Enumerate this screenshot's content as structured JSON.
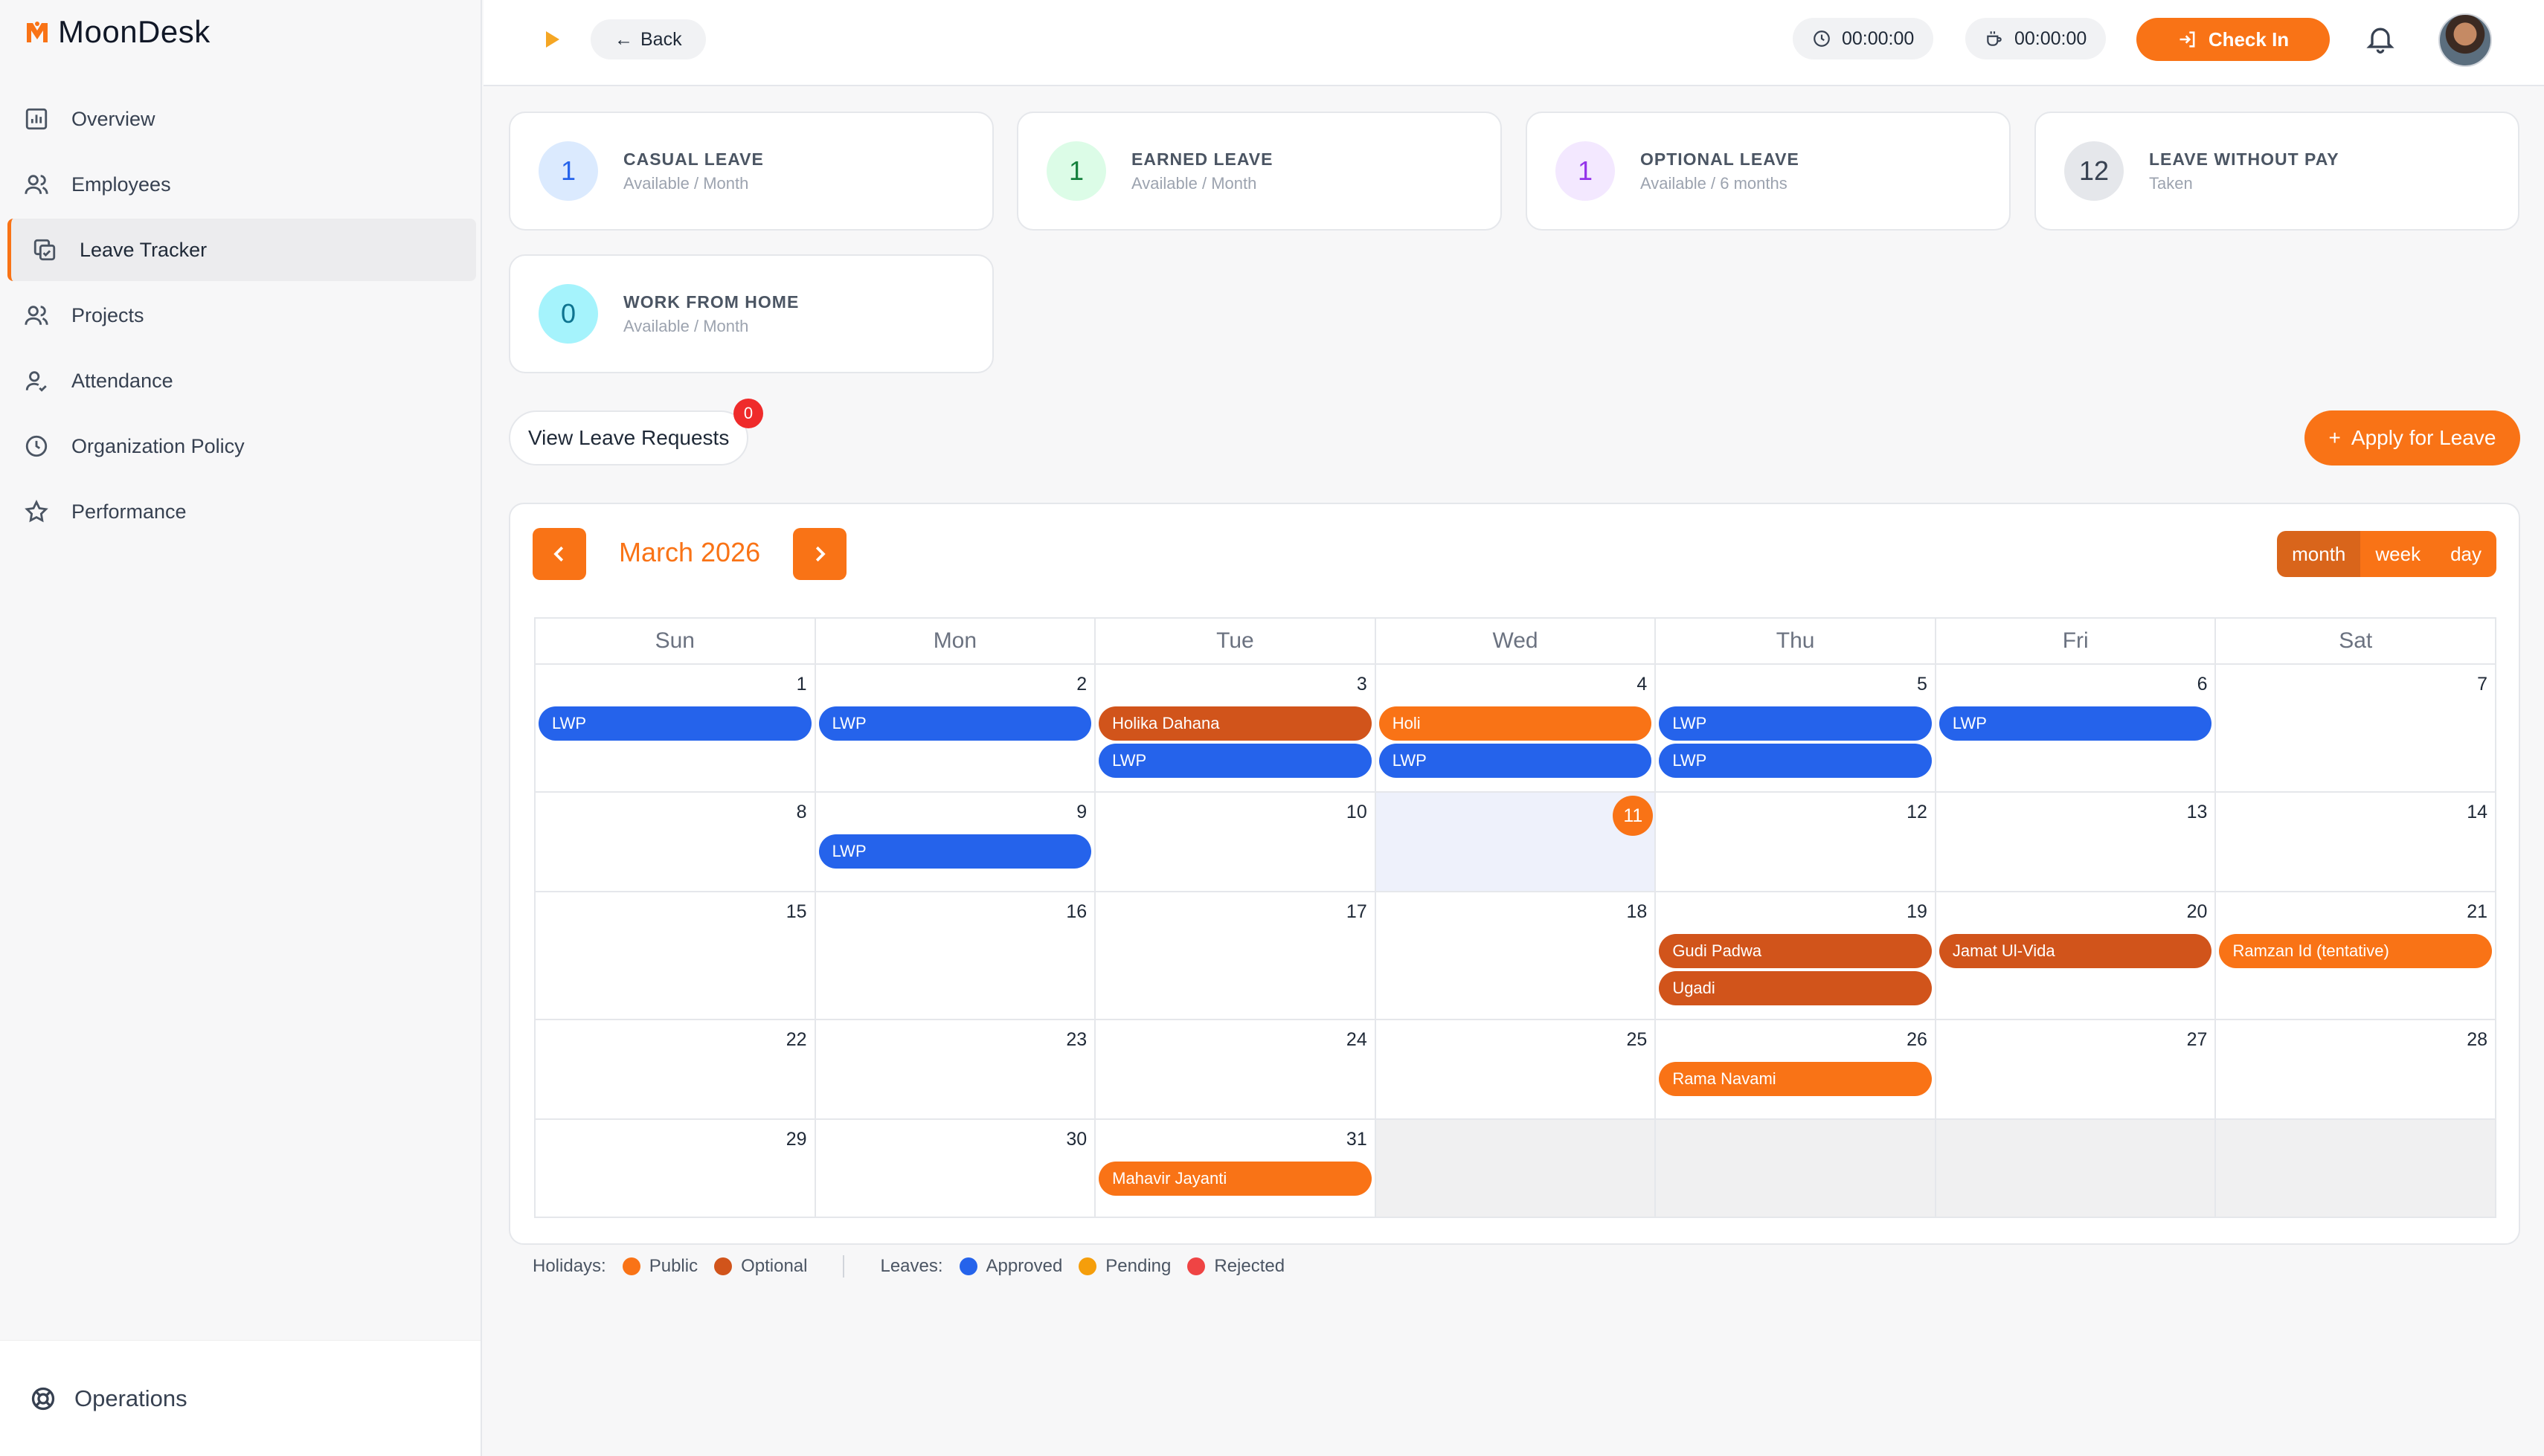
{
  "app": {
    "name": "MoonDesk"
  },
  "sidebar": {
    "items": [
      {
        "label": "Overview",
        "icon": "chart-icon"
      },
      {
        "label": "Employees",
        "icon": "users-icon"
      },
      {
        "label": "Leave Tracker",
        "icon": "copy-icon",
        "active": true
      },
      {
        "label": "Projects",
        "icon": "users-icon"
      },
      {
        "label": "Attendance",
        "icon": "user-check-icon"
      },
      {
        "label": "Organization Policy",
        "icon": "clock-icon"
      },
      {
        "label": "Performance",
        "icon": "star-icon"
      }
    ],
    "footer": {
      "label": "Operations"
    }
  },
  "topbar": {
    "back_label": "Back",
    "work_timer": "00:00:00",
    "break_timer": "00:00:00",
    "checkin_label": "Check In"
  },
  "cards": [
    {
      "num": "1",
      "title": "CASUAL LEAVE",
      "sub": "Available / Month",
      "color": "#2563eb",
      "bg": "#dbeafe"
    },
    {
      "num": "1",
      "title": "EARNED LEAVE",
      "sub": "Available / Month",
      "color": "#15803d",
      "bg": "#dcfce7"
    },
    {
      "num": "1",
      "title": "OPTIONAL LEAVE",
      "sub": "Available / 6 months",
      "color": "#9333ea",
      "bg": "#f3e8ff"
    },
    {
      "num": "12",
      "title": "LEAVE WITHOUT PAY",
      "sub": "Taken",
      "color": "#374151",
      "bg": "#e5e7eb"
    },
    {
      "num": "0",
      "title": "WORK FROM HOME",
      "sub": "Available / Month",
      "color": "#0e7490",
      "bg": "#a5f3fc"
    }
  ],
  "requests": {
    "label": "View Leave Requests",
    "count": "0"
  },
  "apply": {
    "label": "Apply for Leave",
    "plus": "+"
  },
  "calendar": {
    "title": "March 2026",
    "views": [
      "month",
      "week",
      "day"
    ],
    "active_view": "month",
    "dow": [
      "Sun",
      "Mon",
      "Tue",
      "Wed",
      "Thu",
      "Fri",
      "Sat"
    ],
    "weeks": [
      [
        {
          "d": "1",
          "events": [
            {
              "t": "LWP",
              "k": "lwp"
            }
          ]
        },
        {
          "d": "2",
          "events": [
            {
              "t": "LWP",
              "k": "lwp"
            }
          ]
        },
        {
          "d": "3",
          "events": [
            {
              "t": "Holika Dahana",
              "k": "optional"
            },
            {
              "t": "LWP",
              "k": "lwp"
            }
          ]
        },
        {
          "d": "4",
          "events": [
            {
              "t": "Holi",
              "k": "public"
            },
            {
              "t": "LWP",
              "k": "lwp"
            }
          ]
        },
        {
          "d": "5",
          "events": [
            {
              "t": "LWP",
              "k": "lwp"
            },
            {
              "t": "LWP",
              "k": "lwp"
            }
          ]
        },
        {
          "d": "6",
          "events": [
            {
              "t": "LWP",
              "k": "lwp"
            }
          ]
        },
        {
          "d": "7",
          "events": []
        }
      ],
      [
        {
          "d": "8",
          "events": []
        },
        {
          "d": "9",
          "events": [
            {
              "t": "LWP",
              "k": "lwp"
            }
          ]
        },
        {
          "d": "10",
          "events": []
        },
        {
          "d": "11",
          "events": [],
          "today": true
        },
        {
          "d": "12",
          "events": []
        },
        {
          "d": "13",
          "events": []
        },
        {
          "d": "14",
          "events": []
        }
      ],
      [
        {
          "d": "15",
          "events": []
        },
        {
          "d": "16",
          "events": []
        },
        {
          "d": "17",
          "events": []
        },
        {
          "d": "18",
          "events": []
        },
        {
          "d": "19",
          "events": [
            {
              "t": "Gudi Padwa",
              "k": "optional"
            },
            {
              "t": "Ugadi",
              "k": "optional"
            }
          ]
        },
        {
          "d": "20",
          "events": [
            {
              "t": "Jamat Ul-Vida",
              "k": "optional"
            }
          ]
        },
        {
          "d": "21",
          "events": [
            {
              "t": "Ramzan Id (tentative)",
              "k": "public"
            }
          ]
        }
      ],
      [
        {
          "d": "22",
          "events": []
        },
        {
          "d": "23",
          "events": []
        },
        {
          "d": "24",
          "events": []
        },
        {
          "d": "25",
          "events": []
        },
        {
          "d": "26",
          "events": [
            {
              "t": "Rama Navami",
              "k": "public"
            }
          ]
        },
        {
          "d": "27",
          "events": []
        },
        {
          "d": "28",
          "events": []
        }
      ],
      [
        {
          "d": "29",
          "events": []
        },
        {
          "d": "30",
          "events": []
        },
        {
          "d": "31",
          "events": [
            {
              "t": "Mahavir Jayanti",
              "k": "public"
            }
          ]
        },
        {
          "d": "",
          "events": [],
          "off": true
        },
        {
          "d": "",
          "events": [],
          "off": true
        },
        {
          "d": "",
          "events": [],
          "off": true
        },
        {
          "d": "",
          "events": [],
          "off": true
        }
      ]
    ]
  },
  "legend": {
    "holidays_label": "Holidays:",
    "holidays": [
      {
        "label": "Public",
        "color": "#f97316"
      },
      {
        "label": "Optional",
        "color": "#d1541b"
      }
    ],
    "leaves_label": "Leaves:",
    "leaves": [
      {
        "label": "Approved",
        "color": "#2563eb"
      },
      {
        "label": "Pending",
        "color": "#f59e0b"
      },
      {
        "label": "Rejected",
        "color": "#ef4444"
      }
    ]
  }
}
